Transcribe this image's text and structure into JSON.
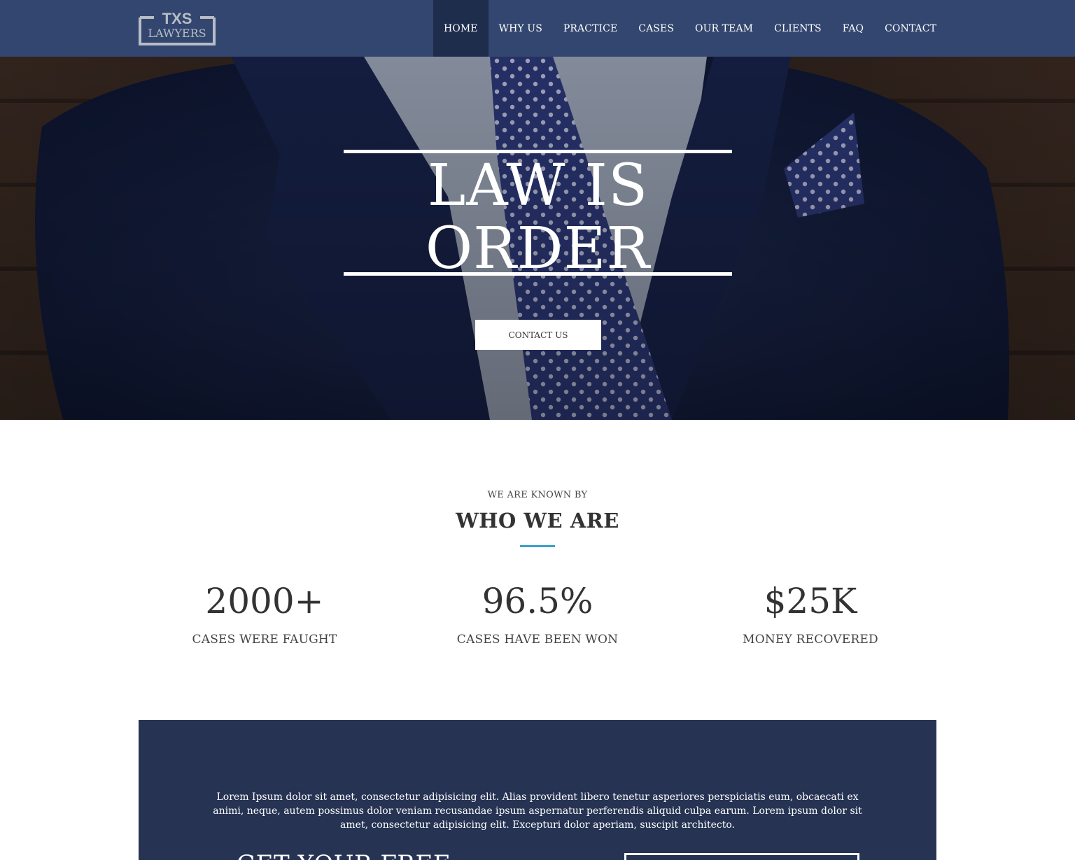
{
  "brand": {
    "logo_top": "TXS",
    "logo_bottom": "LAWYERS",
    "nav_bg": "#33466f",
    "accent": "#3aa0c8"
  },
  "nav": {
    "items": [
      {
        "label": "HOME",
        "active": true
      },
      {
        "label": "WHY US"
      },
      {
        "label": "PRACTICE"
      },
      {
        "label": "CASES"
      },
      {
        "label": "OUR TEAM"
      },
      {
        "label": "CLIENTS"
      },
      {
        "label": "FAQ"
      },
      {
        "label": "CONTACT"
      }
    ]
  },
  "hero": {
    "title_line1": "LAW IS",
    "title_line2": "ORDER",
    "button_label": "CONTACT US"
  },
  "about": {
    "subtitle": "WE ARE KNOWN BY",
    "title": "WHO WE ARE",
    "stats": [
      {
        "value": "2000+",
        "label": "CASES WERE FAUGHT"
      },
      {
        "value": "96.5%",
        "label": "CASES HAVE BEEN WON"
      },
      {
        "value": "$25K",
        "label": "MONEY RECOVERED"
      }
    ]
  },
  "cta": {
    "text": "Lorem Ipsum dolor sit amet, consectetur adipisicing elit. Alias provident libero tenetur asperiores perspiciatis eum, obcaecati ex animi, neque, autem possimus dolor veniam recusandae ipsum aspernatur perferendis aliquid culpa earum. Lorem ipsum dolor sit amet, consectetur adipisicing elit. Excepturi dolor aperiam, suscipit architecto.",
    "heading": "GET YOUR FREE"
  }
}
